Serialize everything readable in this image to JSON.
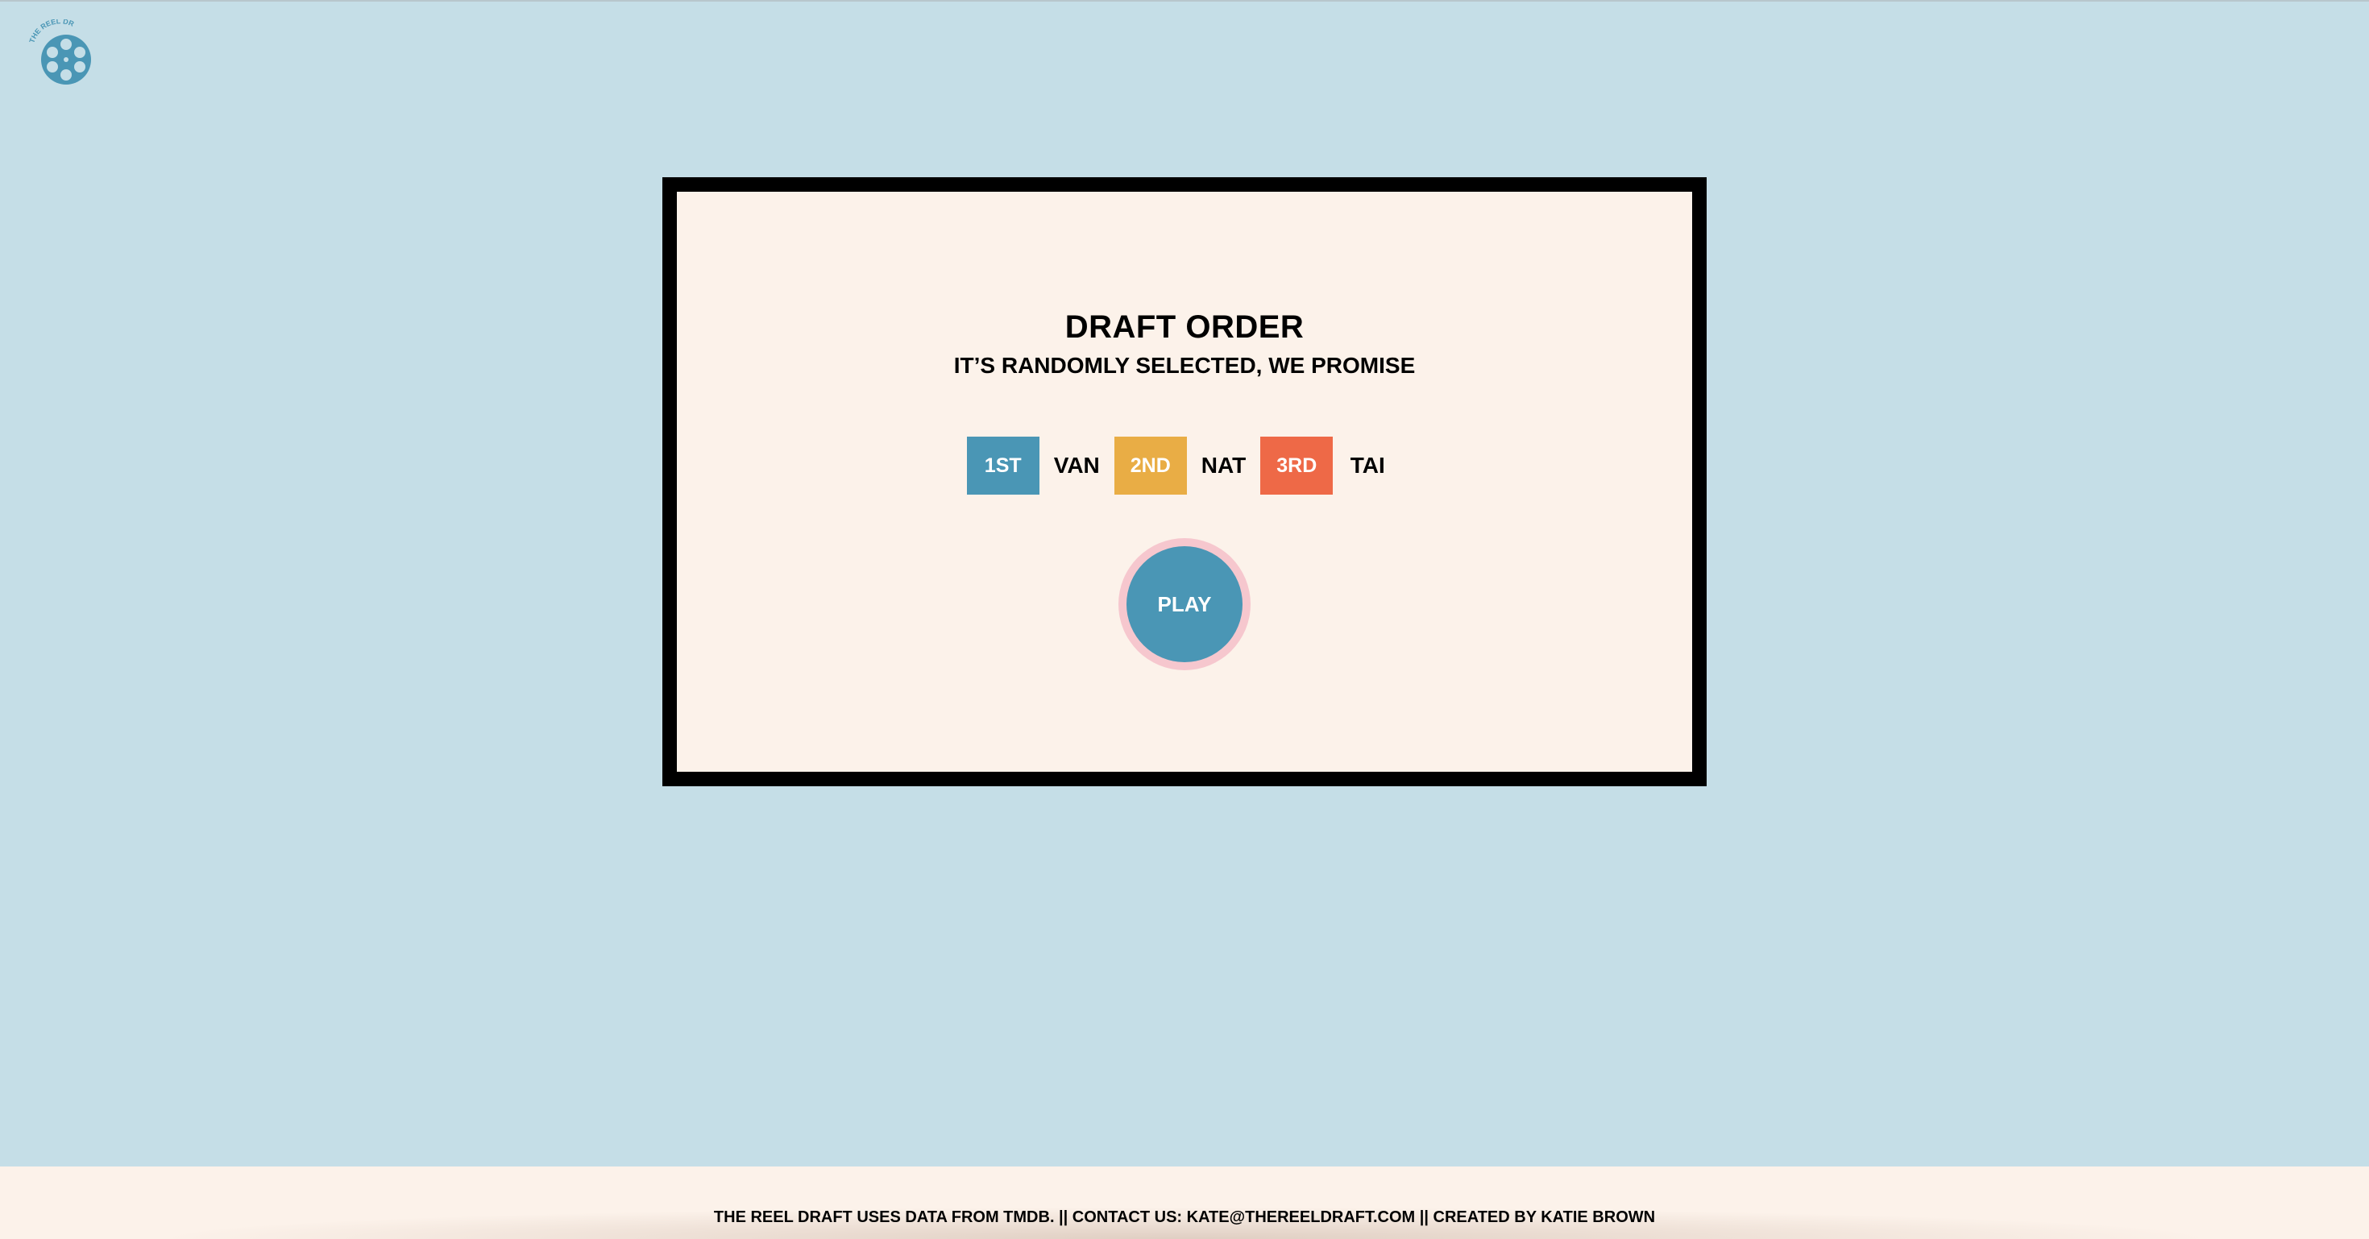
{
  "logo": {
    "text": "THE REEL DRAFT",
    "icon": "film-reel-icon",
    "color": "#4a96b5"
  },
  "card": {
    "title": "DRAFT ORDER",
    "subtitle": "IT’S RANDOMLY SELECTED, WE PROMISE",
    "order": [
      {
        "rank": "1ST",
        "player": "VAN",
        "color": "#4a96b5"
      },
      {
        "rank": "2ND",
        "player": "NAT",
        "color": "#e9ad45"
      },
      {
        "rank": "3RD",
        "player": "TAI",
        "color": "#ee6947"
      }
    ],
    "play_label": "PLAY"
  },
  "footer": {
    "text": "THE REEL DRAFT USES DATA FROM TMDB. || CONTACT US: KATE@THEREELDRAFT.COM || CREATED BY KATIE BROWN"
  },
  "colors": {
    "background": "#c5dee7",
    "card": "#fcf2ea",
    "border": "#000000",
    "play_ring": "#f6c7ce"
  }
}
